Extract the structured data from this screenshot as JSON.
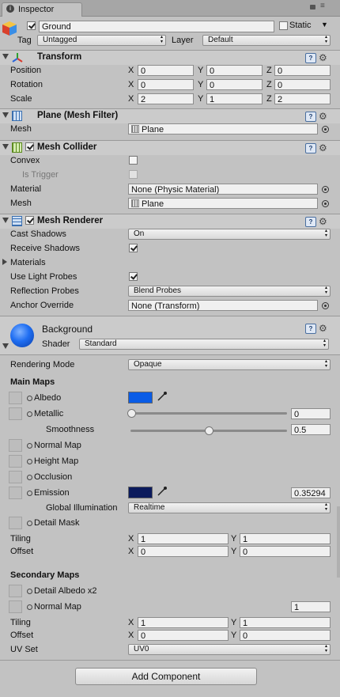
{
  "tab": {
    "title": "Inspector"
  },
  "object": {
    "name": "Ground",
    "static_label": "Static",
    "tag_label": "Tag",
    "tag_value": "Untagged",
    "layer_label": "Layer",
    "layer_value": "Default"
  },
  "transform": {
    "title": "Transform",
    "position": {
      "label": "Position",
      "x": "0",
      "y": "0",
      "z": "0"
    },
    "rotation": {
      "label": "Rotation",
      "x": "0",
      "y": "0",
      "z": "0"
    },
    "scale": {
      "label": "Scale",
      "x": "2",
      "y": "1",
      "z": "2"
    },
    "axis": {
      "x": "X",
      "y": "Y",
      "z": "Z"
    }
  },
  "mesh_filter": {
    "title": "Plane (Mesh Filter)",
    "mesh_label": "Mesh",
    "mesh_value": "Plane"
  },
  "mesh_collider": {
    "title": "Mesh Collider",
    "convex_label": "Convex",
    "trigger_label": "Is Trigger",
    "material_label": "Material",
    "material_value": "None (Physic Material)",
    "mesh_label": "Mesh",
    "mesh_value": "Plane"
  },
  "mesh_renderer": {
    "title": "Mesh Renderer",
    "cast_label": "Cast Shadows",
    "cast_value": "On",
    "receive_label": "Receive Shadows",
    "materials_label": "Materials",
    "light_probes_label": "Use Light Probes",
    "reflection_label": "Reflection Probes",
    "reflection_value": "Blend Probes",
    "anchor_label": "Anchor Override",
    "anchor_value": "None (Transform)"
  },
  "material": {
    "name": "Background",
    "shader_label": "Shader",
    "shader_value": "Standard"
  },
  "standard": {
    "rendering_mode_label": "Rendering Mode",
    "rendering_mode_value": "Opaque",
    "main_maps": "Main Maps",
    "albedo": "Albedo",
    "metallic": "Metallic",
    "metallic_value": "0",
    "smoothness": "Smoothness",
    "smoothness_value": "0.5",
    "normal_map": "Normal Map",
    "height_map": "Height Map",
    "occlusion": "Occlusion",
    "emission": "Emission",
    "emission_value": "0.35294",
    "gi_label": "Global Illumination",
    "gi_value": "Realtime",
    "detail_mask": "Detail Mask",
    "tiling_label": "Tiling",
    "tiling_x": "1",
    "tiling_y": "1",
    "offset_label": "Offset",
    "offset_x": "0",
    "offset_y": "0",
    "secondary_maps": "Secondary Maps",
    "detail_albedo": "Detail Albedo x2",
    "secondary_normal": "Normal Map",
    "secondary_normal_value": "1",
    "tiling2_label": "Tiling",
    "tiling2_x": "1",
    "tiling2_y": "1",
    "offset2_label": "Offset",
    "offset2_x": "0",
    "offset2_y": "0",
    "uv_label": "UV Set",
    "uv_value": "UV0"
  },
  "add_component": "Add Component",
  "colors": {
    "albedo": "#0a5ce6",
    "emission": "#0b1a5c",
    "sphere": "#1f6ef2"
  }
}
